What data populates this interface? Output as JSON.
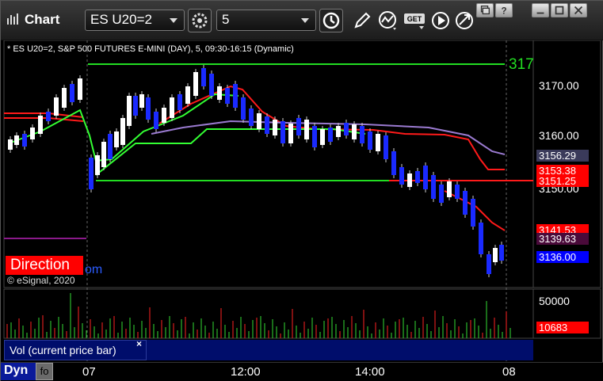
{
  "toolbar": {
    "title": "Chart",
    "symbol": "ES U20=2",
    "interval": "5"
  },
  "chart": {
    "info": "* ES U20=2, S&P 500 FUTURES E-MINI (DAY), 5, 09:30-16:15 (Dynamic)",
    "edge_label": "317",
    "axis_labels": [
      "3170.00",
      "3160.00",
      "3150.00"
    ],
    "price_tags": [
      {
        "text": "3156.29",
        "bg": "#3a3a5a",
        "fg": "#ffffff"
      },
      {
        "text": "3153.38",
        "bg": "#ff0000",
        "fg": "#ffffff"
      },
      {
        "text": "3151.25",
        "bg": "#ff0000",
        "fg": "#ffffff"
      },
      {
        "text": "3141.53",
        "bg": "#ff0000",
        "fg": "#ffffff"
      },
      {
        "text": "3139.63",
        "bg": "#4a0a3a",
        "fg": "#ffffff"
      },
      {
        "text": "3136.00",
        "bg": "#0000ff",
        "fg": "#ffffff"
      }
    ],
    "direction_label": "Direction",
    "direction_suffix": "om",
    "copyright": "© eSignal, 2020"
  },
  "volume": {
    "axis_label": "50000",
    "current_tag": "10683",
    "legend": "Vol (current price bar)",
    "close": "×"
  },
  "bottom": {
    "dyn": "Dyn",
    "dyn_icon": "fo",
    "time_labels": [
      "07",
      "12:00",
      "14:00",
      "08"
    ]
  },
  "colors": {
    "up_candle": "#ffffff",
    "down_candle": "#1a2aff",
    "ma_red": "#ff1a1a",
    "ma_green": "#33ff33",
    "ma_purple": "#9a7ad0",
    "level_green": "#22dd22"
  }
}
